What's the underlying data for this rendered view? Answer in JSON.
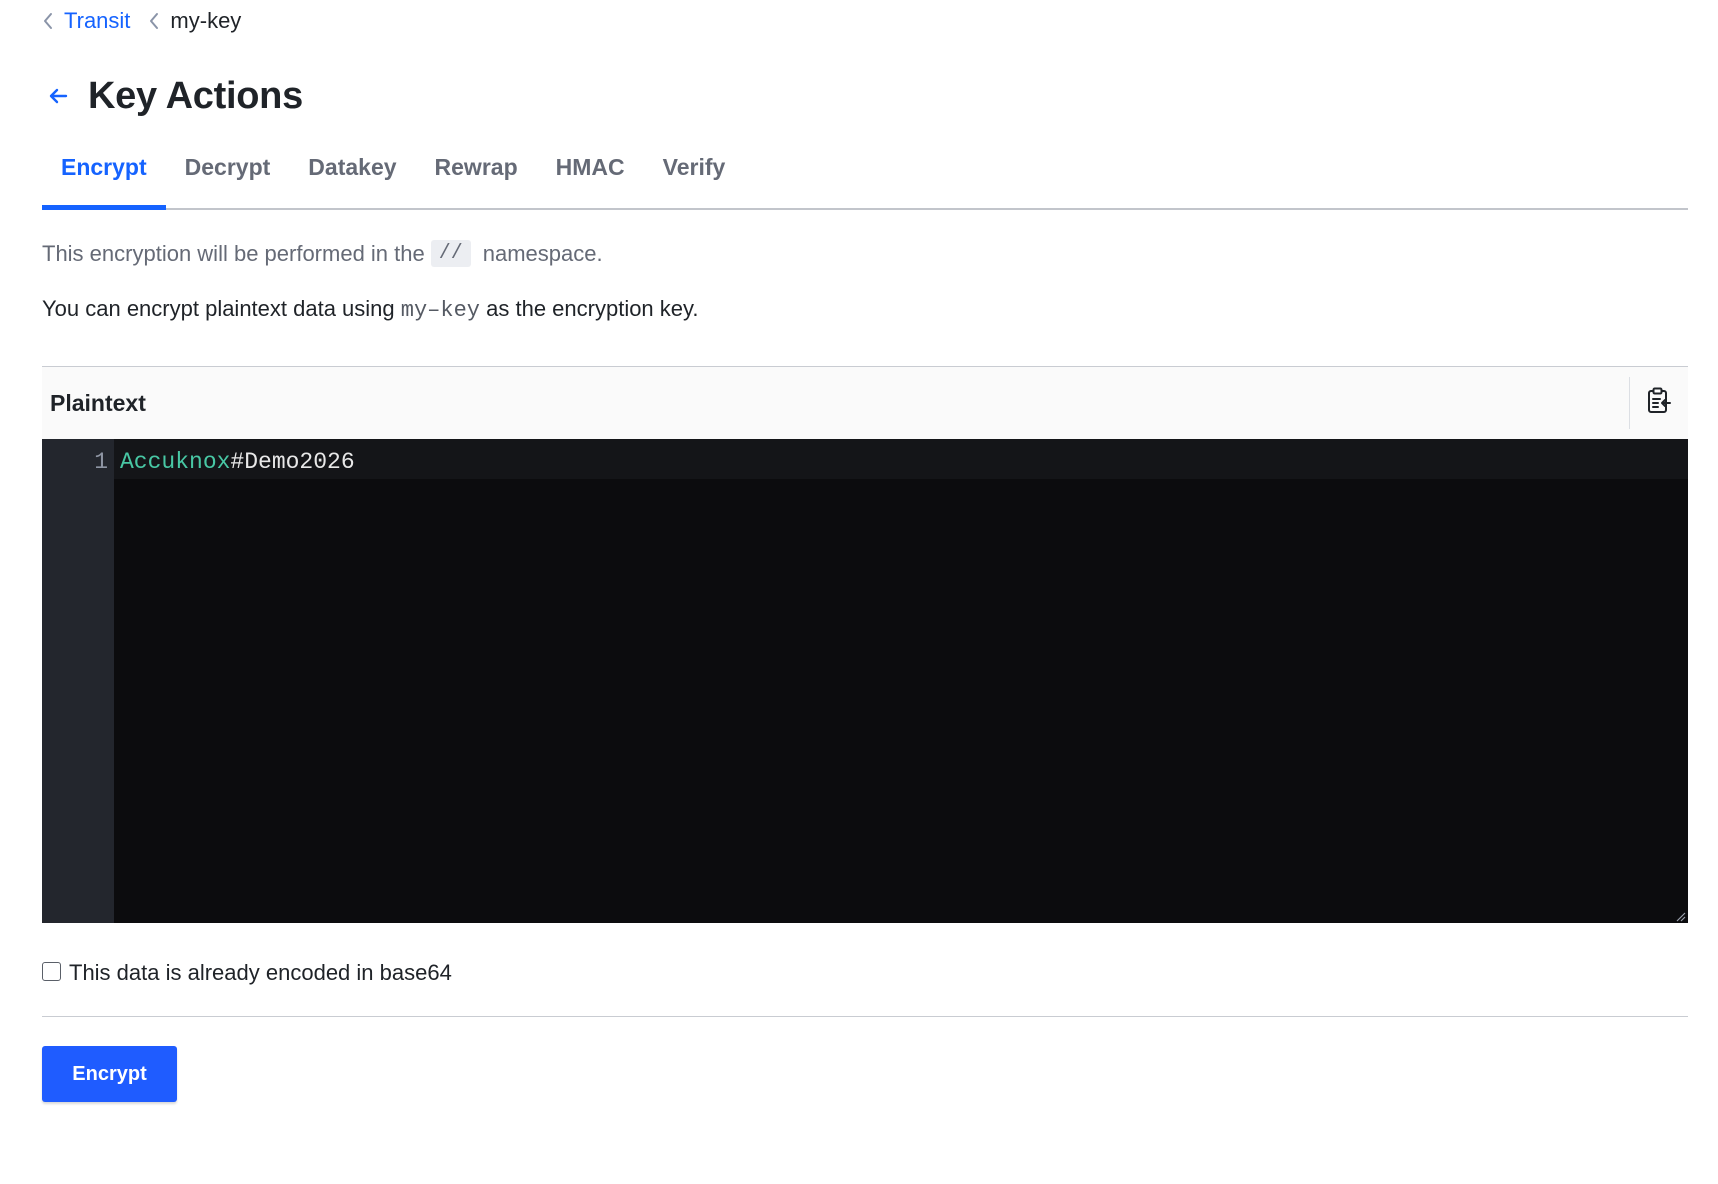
{
  "breadcrumb": {
    "parent_label": "Transit",
    "current_label": "my-key"
  },
  "page": {
    "title": "Key Actions"
  },
  "tabs": [
    {
      "label": "Encrypt",
      "active": true
    },
    {
      "label": "Decrypt",
      "active": false
    },
    {
      "label": "Datakey",
      "active": false
    },
    {
      "label": "Rewrap",
      "active": false
    },
    {
      "label": "HMAC",
      "active": false
    },
    {
      "label": "Verify",
      "active": false
    }
  ],
  "namespace_notice": {
    "prefix": "This encryption will be performed in the",
    "namespace": "//",
    "suffix": "namespace."
  },
  "description": {
    "prefix": "You can encrypt plaintext data using",
    "key_name": "my–key",
    "suffix": "as the encryption key."
  },
  "plaintext_editor": {
    "label": "Plaintext",
    "line_number": "1",
    "value_part1": "Accuknox",
    "value_part2": "#Demo2026"
  },
  "base64_checkbox": {
    "label": "This data is already encoded in base64",
    "checked": false
  },
  "actions": {
    "encrypt_label": "Encrypt"
  },
  "colors": {
    "accent": "#1563ff",
    "button": "#1f5cff",
    "editor_bg": "#0c0c0e",
    "gutter_bg": "#23262d",
    "token_green": "#48c7a4"
  },
  "icons": {
    "breadcrumb_separator": "chevron-left-icon",
    "back": "arrow-left-icon",
    "editor_tool": "clipboard-icon"
  }
}
